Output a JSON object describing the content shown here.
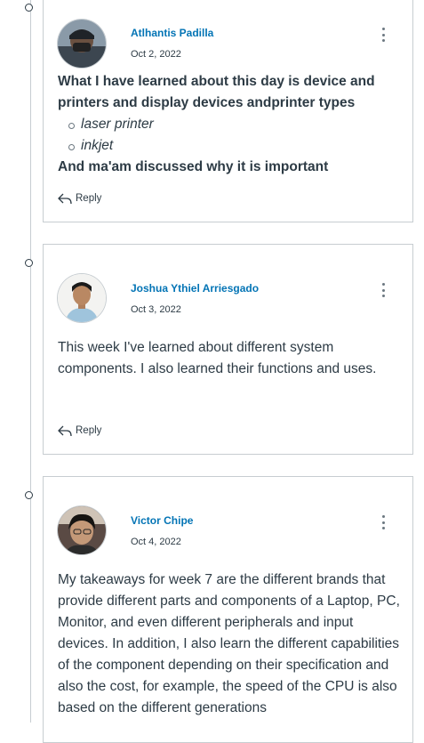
{
  "posts": [
    {
      "author": "Atlhantis Padilla",
      "date": "Oct 2, 2022",
      "lines": [
        "What I have learned about this day is device and printers and display devices andprinter types"
      ],
      "bullets": [
        "laser printer",
        "inkjet"
      ],
      "closing": "And ma'am discussed why it is important",
      "reply_label": "Reply"
    },
    {
      "author": "Joshua Ythiel Arriesgado",
      "date": "Oct 3, 2022",
      "text": "This week I've learned about different system components. I also learned their functions and uses.",
      "reply_label": "Reply"
    },
    {
      "author": "Victor Chipe",
      "date": "Oct 4, 2022",
      "text": "My takeaways for week 7  are the different brands that provide different parts and components of a Laptop, PC, Monitor, and even different peripherals and input devices. In addition, I also learn the different capabilities of the component depending on their specification and also the cost, for example, the speed of the CPU is also based on the different generations"
    }
  ],
  "colors": {
    "link": "#0374b5",
    "text": "#2d3b45",
    "border": "#c7cdd1"
  }
}
